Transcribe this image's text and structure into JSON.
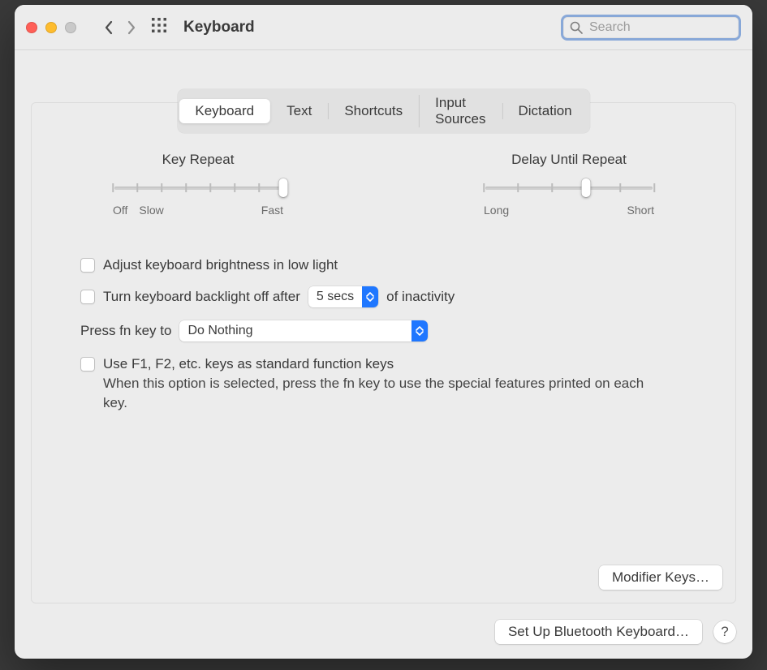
{
  "window": {
    "title": "Keyboard"
  },
  "search": {
    "placeholder": "Search",
    "value": ""
  },
  "tabs": [
    {
      "label": "Keyboard",
      "active": true
    },
    {
      "label": "Text",
      "active": false
    },
    {
      "label": "Shortcuts",
      "active": false
    },
    {
      "label": "Input Sources",
      "active": false
    },
    {
      "label": "Dictation",
      "active": false
    }
  ],
  "sliders": {
    "key_repeat": {
      "label": "Key Repeat",
      "left_label_1": "Off",
      "left_label_2": "Slow",
      "right_label": "Fast",
      "ticks": 8,
      "value": 7
    },
    "delay_until_repeat": {
      "label": "Delay Until Repeat",
      "left_label": "Long",
      "right_label": "Short",
      "ticks": 6,
      "value": 3
    }
  },
  "options": {
    "adjust_brightness": {
      "label": "Adjust keyboard brightness in low light",
      "checked": false
    },
    "backlight_off": {
      "label_before": "Turn keyboard backlight off after",
      "value": "5 secs",
      "label_after": "of inactivity",
      "checked": false
    },
    "press_fn": {
      "label": "Press fn key to",
      "value": "Do Nothing"
    },
    "use_fkeys": {
      "label": "Use F1, F2, etc. keys as standard function keys",
      "description": "When this option is selected, press the fn key to use the special features printed on each key.",
      "checked": false
    }
  },
  "buttons": {
    "modifier_keys": "Modifier Keys…",
    "bluetooth_kbd": "Set Up Bluetooth Keyboard…",
    "help": "?"
  }
}
